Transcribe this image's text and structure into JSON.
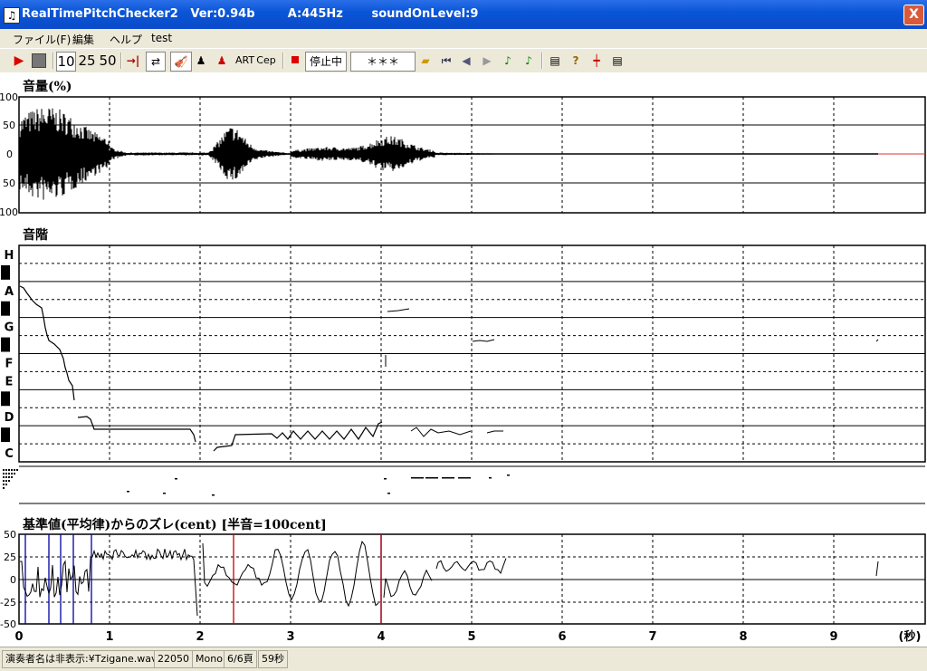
{
  "window": {
    "title": "RealTimePitchChecker2   Ver:0.94b        A:445Hz       soundOnLevel:9",
    "close_label": "X"
  },
  "menu": [
    {
      "label": "ファイル(F)"
    },
    {
      "label": "編集"
    },
    {
      "label": "ヘルプ"
    },
    {
      "label": "test"
    }
  ],
  "toolbar": {
    "speed_buttons": [
      "10",
      "25",
      "50"
    ],
    "art_label": "ART",
    "cep_label": "Cep",
    "status_label": "停止中",
    "asterisk_display": "＊＊＊"
  },
  "volume_panel": {
    "label": "音量(%)",
    "y_ticks": [
      "100",
      "50",
      "0",
      "50",
      "100"
    ]
  },
  "pitch_panel": {
    "label": "音階",
    "notes": [
      "H",
      "A",
      "G",
      "F",
      "E",
      "D",
      "C"
    ]
  },
  "deviation_panel": {
    "label": "基準値(平均律)からのズレ(cent) [半音=100cent]",
    "y_ticks": [
      "50",
      "25",
      "0",
      "-25",
      "-50"
    ],
    "x_ticks": [
      "0",
      "1",
      "2",
      "3",
      "4",
      "5",
      "6",
      "7",
      "8",
      "9"
    ],
    "x_unit": "(秒)"
  },
  "statusbar": {
    "file": "演奏者名は非表示:¥Tzigane.wav",
    "rate": "22050",
    "channels": "Mono",
    "page": "6/6頁",
    "duration": "59秒"
  },
  "colors": {
    "titlebar": "#0a55d8",
    "grid": "#000000",
    "deviation_marker_red": "#c00000",
    "deviation_marker_blue": "#0000a0"
  }
}
